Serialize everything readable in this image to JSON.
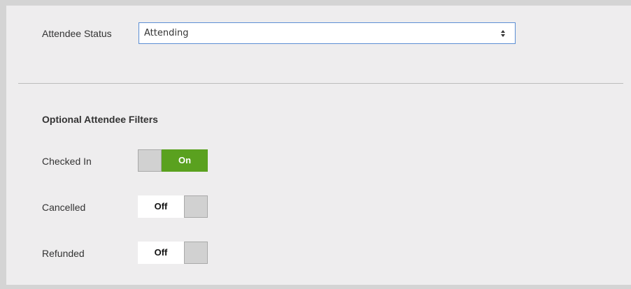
{
  "attendee_status": {
    "label": "Attendee Status",
    "selected": "Attending",
    "icon": "chevron-updown-icon"
  },
  "optional_filters": {
    "title": "Optional Attendee Filters",
    "items": [
      {
        "label": "Checked In",
        "state": "On",
        "enabled": true
      },
      {
        "label": "Cancelled",
        "state": "Off",
        "enabled": false
      },
      {
        "label": "Refunded",
        "state": "Off",
        "enabled": false
      }
    ]
  },
  "colors": {
    "on": "#5aa11f",
    "off": "#ffffff",
    "knob": "#d1d1d1",
    "select_border": "#5b8ed4",
    "panel": "#eeedee"
  }
}
